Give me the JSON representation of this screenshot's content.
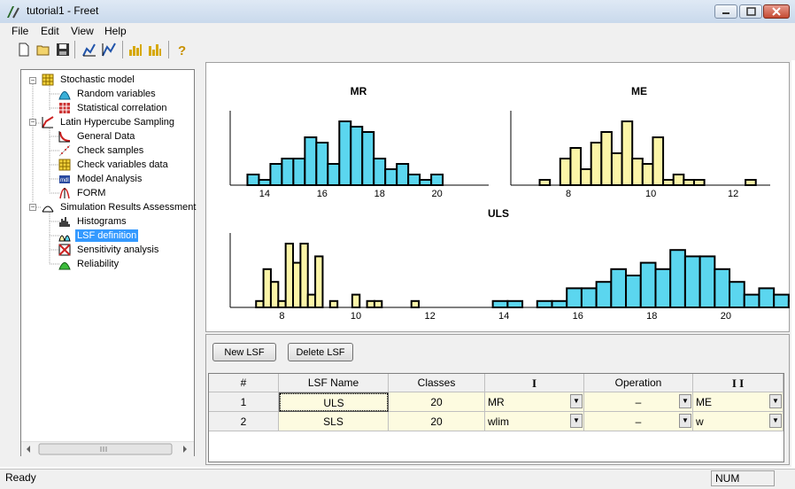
{
  "window": {
    "title": "tutorial1 - Freet"
  },
  "menu": [
    "File",
    "Edit",
    "View",
    "Help"
  ],
  "toolbar": {
    "icons": [
      "new-file-icon",
      "open-folder-icon",
      "save-icon",
      "chart-a-icon",
      "chart-b-icon",
      "bars-a-icon",
      "bars-b-icon",
      "help-icon"
    ]
  },
  "tree": {
    "items": [
      {
        "label": "Stochastic model",
        "level": 0,
        "icon": "grid-icon"
      },
      {
        "label": "Random variables",
        "level": 1,
        "icon": "distribution-icon"
      },
      {
        "label": "Statistical correlation",
        "level": 1,
        "icon": "matrix-icon"
      },
      {
        "label": "Latin Hypercube Sampling",
        "level": 0,
        "icon": "lhs-icon"
      },
      {
        "label": "General Data",
        "level": 1,
        "icon": "curve-icon"
      },
      {
        "label": "Check samples",
        "level": 1,
        "icon": "scatter-icon"
      },
      {
        "label": "Check variables data",
        "level": 1,
        "icon": "grid-icon"
      },
      {
        "label": "Model Analysis",
        "level": 1,
        "icon": "model-icon"
      },
      {
        "label": "FORM",
        "level": 1,
        "icon": "form-icon"
      },
      {
        "label": "Simulation Results Assessment",
        "level": 0,
        "icon": "results-icon"
      },
      {
        "label": "Histograms",
        "level": 1,
        "icon": "histogram-icon"
      },
      {
        "label": "LSF definition",
        "level": 1,
        "icon": "lsf-icon",
        "selected": true
      },
      {
        "label": "Sensitivity analysis",
        "level": 1,
        "icon": "sensitivity-icon"
      },
      {
        "label": "Reliability",
        "level": 1,
        "icon": "reliability-icon"
      }
    ]
  },
  "buttons": {
    "new_lsf": "New LSF",
    "delete_lsf": "Delete LSF"
  },
  "table": {
    "headers": [
      "#",
      "LSF Name",
      "Classes",
      "I",
      "Operation",
      "I I"
    ],
    "rows": [
      {
        "num": "1",
        "name": "ULS",
        "classes": "20",
        "i": "MR",
        "op": "–",
        "ii": "ME"
      },
      {
        "num": "2",
        "name": "SLS",
        "classes": "20",
        "i": "wlim",
        "op": "–",
        "ii": "w"
      }
    ]
  },
  "status": {
    "text": "Ready",
    "num": "NUM"
  },
  "colors": {
    "blue_bar": "#5bd6ef",
    "yellow_bar": "#fcf5a8",
    "selection": "#3399ff"
  },
  "chart_data": [
    {
      "type": "bar",
      "title": "MR",
      "color": "#5bd6ef",
      "xlim": [
        12.8,
        21.8
      ],
      "x_ticks": [
        "14",
        "16",
        "18",
        "20"
      ],
      "bin_edges_start": 13.4,
      "bin_width": 0.4,
      "counts": [
        2,
        1,
        4,
        5,
        5,
        9,
        8,
        4,
        12,
        11,
        10,
        5,
        3,
        4,
        2,
        1,
        2
      ]
    },
    {
      "type": "bar",
      "title": "ME",
      "color": "#fcf5a8",
      "xlim": [
        6.6,
        12.9
      ],
      "x_ticks": [
        "8",
        "10",
        "12"
      ],
      "bin_edges_start": 7.3,
      "bin_width": 0.25,
      "counts": [
        1,
        0,
        5,
        7,
        3,
        8,
        10,
        6,
        12,
        5,
        4,
        9,
        1,
        2,
        1,
        1,
        0,
        0,
        0,
        0,
        1
      ]
    },
    {
      "type": "bar",
      "title": "ULS",
      "subtitle_left": "yellow histogram (ME)",
      "color_left": "#fcf5a8",
      "color_right": "#5bd6ef",
      "xlim": [
        6.6,
        21.2
      ],
      "x_ticks": [
        "8",
        "10",
        "12",
        "14",
        "16",
        "18",
        "20"
      ],
      "left": {
        "bin_edges_start": 7.3,
        "bin_width": 0.2,
        "counts": [
          1,
          6,
          4,
          1,
          10,
          7,
          10,
          2,
          8,
          0,
          1,
          0
        ]
      },
      "left_tail": {
        "bin_edges_start": 9.9,
        "bin_width": 0.2,
        "counts": [
          2,
          0,
          1,
          1,
          0,
          0,
          0,
          0,
          1,
          0,
          0
        ]
      },
      "right": {
        "bin_edges_start": 13.7,
        "bin_width": 0.4,
        "counts": [
          1,
          1,
          0,
          1,
          1,
          3,
          3,
          4,
          6,
          5,
          7,
          6,
          9,
          8,
          8,
          6,
          4,
          2,
          3,
          2,
          1,
          2,
          1,
          1
        ]
      }
    }
  ]
}
